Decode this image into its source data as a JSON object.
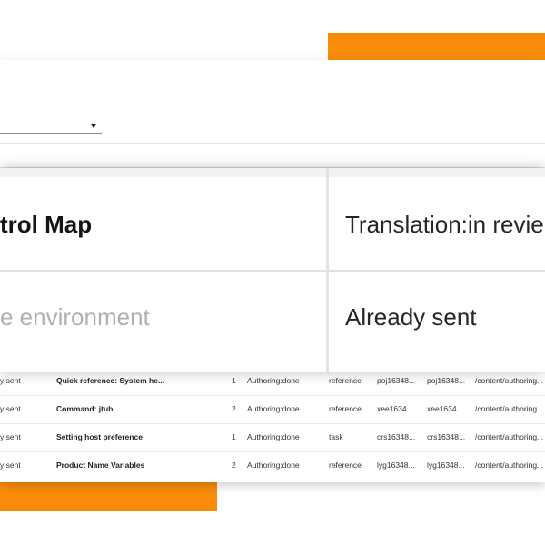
{
  "top_panel": {
    "dropdown_value": ""
  },
  "summary": {
    "cells": [
      {
        "text": "trol Map"
      },
      {
        "text": "Translation:in revie"
      },
      {
        "text": "e environment"
      },
      {
        "text": "Already sent"
      }
    ]
  },
  "table": {
    "rows": [
      {
        "status": "y sent",
        "title": "Quick reference: System he...",
        "count": "1",
        "stage": "Authoring:done",
        "type": "reference",
        "id1": "poj16348...",
        "id2": "poj16348...",
        "path": "/content/authoring..."
      },
      {
        "status": "y sent",
        "title": "Command: jtub",
        "count": "2",
        "stage": "Authoring:done",
        "type": "reference",
        "id1": "xee1634...",
        "id2": "xee1634...",
        "path": "/content/authoring..."
      },
      {
        "status": "y sent",
        "title": "Setting host preference",
        "count": "1",
        "stage": "Authoring:done",
        "type": "task",
        "id1": "crs16348...",
        "id2": "crs16348...",
        "path": "/content/authoring..."
      },
      {
        "status": "y sent",
        "title": "Product Name Variables",
        "count": "2",
        "stage": "Authoring:done",
        "type": "reference",
        "id1": "lyg16348...",
        "id2": "lyg16348...",
        "path": "/content/authoring..."
      }
    ]
  },
  "colors": {
    "accent": "#fb8c0a",
    "muted_text": "#b0b0b0"
  },
  "icons": {
    "dropdown": "chevron-down-icon"
  }
}
